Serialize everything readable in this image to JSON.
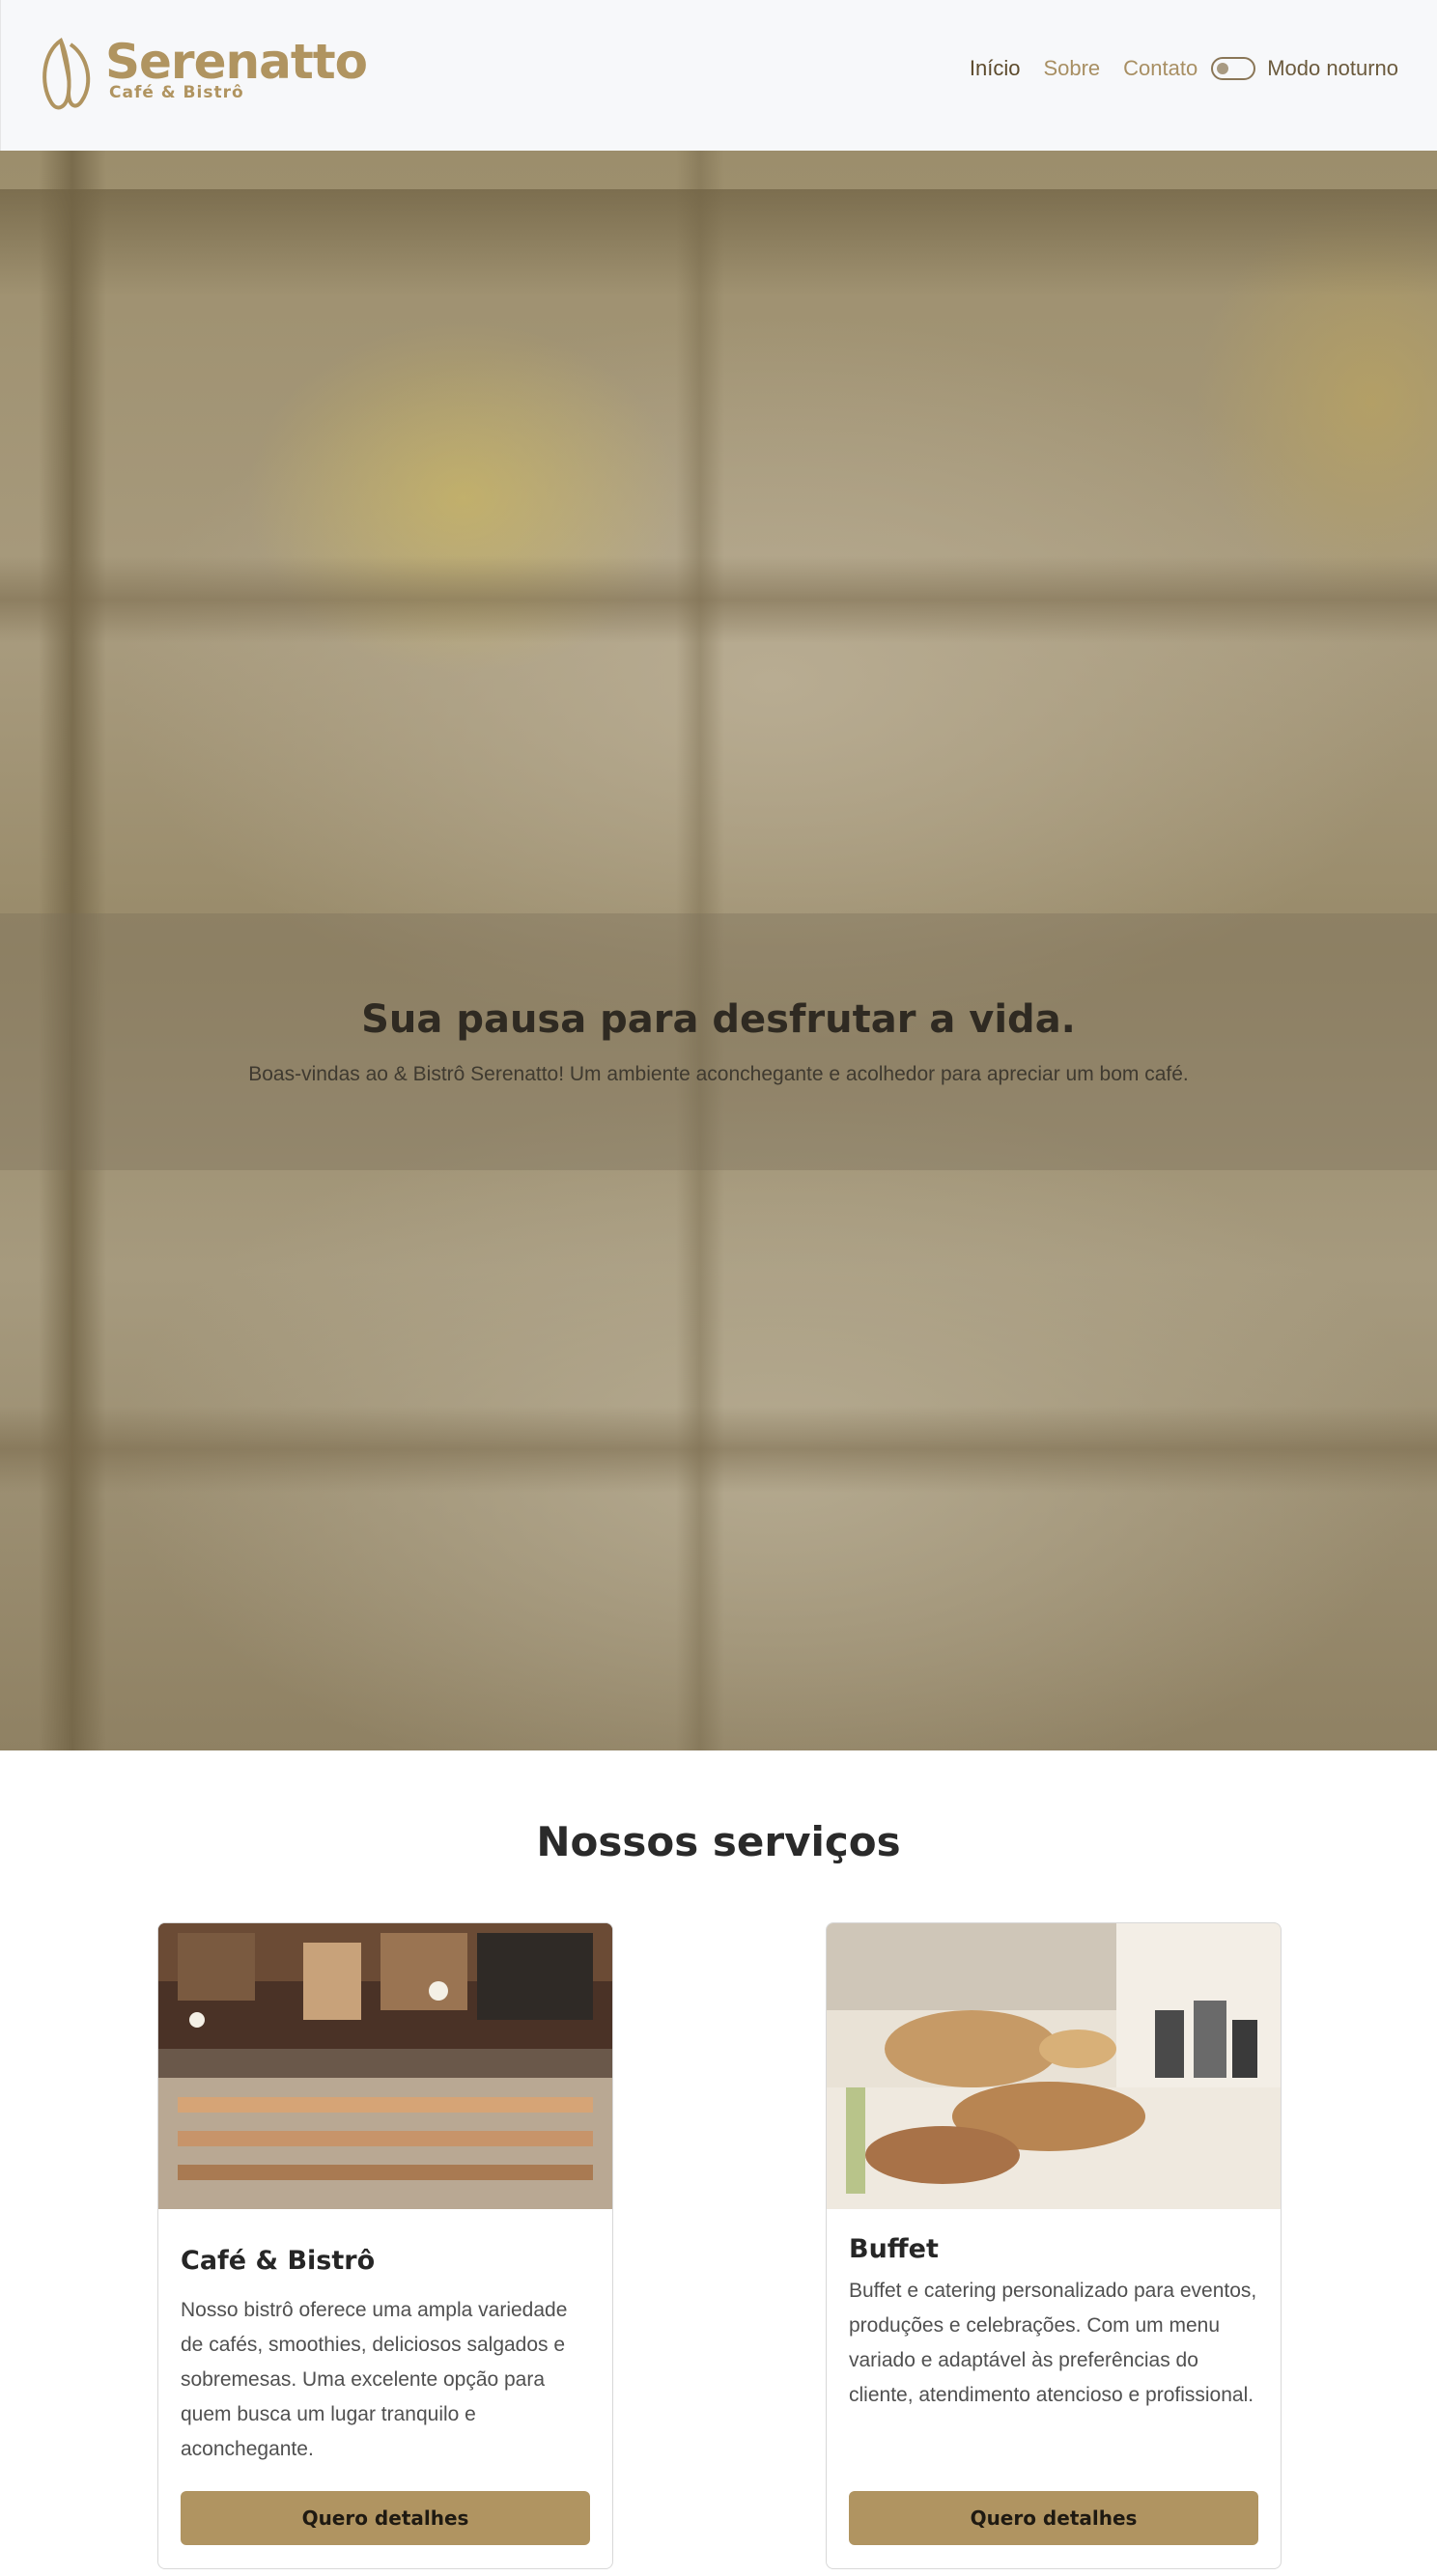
{
  "brand": {
    "name": "Serenatto",
    "tagline": "Café & Bistrô",
    "color": "#b09460"
  },
  "nav": {
    "items": [
      {
        "label": "Início",
        "active": true
      },
      {
        "label": "Sobre",
        "active": false
      },
      {
        "label": "Contato",
        "active": false
      }
    ],
    "dark_mode_label": "Modo noturno",
    "dark_mode_on": false
  },
  "hero": {
    "title": "Sua pausa para desfrutar a vida.",
    "subtitle": "Boas-vindas ao & Bistrô Serenatto! Um ambiente aconchegante e acolhedor para apreciar um bom café."
  },
  "services": {
    "title": "Nossos serviços",
    "cards": [
      {
        "title": "Café & Bistrô",
        "text": "Nosso bistrô oferece uma ampla variedade de cafés, smoothies, deliciosos salgados e sobremesas. Uma excelente opção para quem busca um lugar tranquilo e aconchegante.",
        "button": "Quero detalhes"
      },
      {
        "title": "Buffet",
        "text": "Buffet e catering personalizado para eventos, produções e celebrações. Com um menu variado e adaptável às preferências do cliente, atendimento atencioso e profissional.",
        "button": "Quero detalhes"
      }
    ]
  },
  "colors": {
    "accent": "#b09461",
    "header_bg": "#f7f8fa",
    "text_dark": "#2b2b2b"
  }
}
